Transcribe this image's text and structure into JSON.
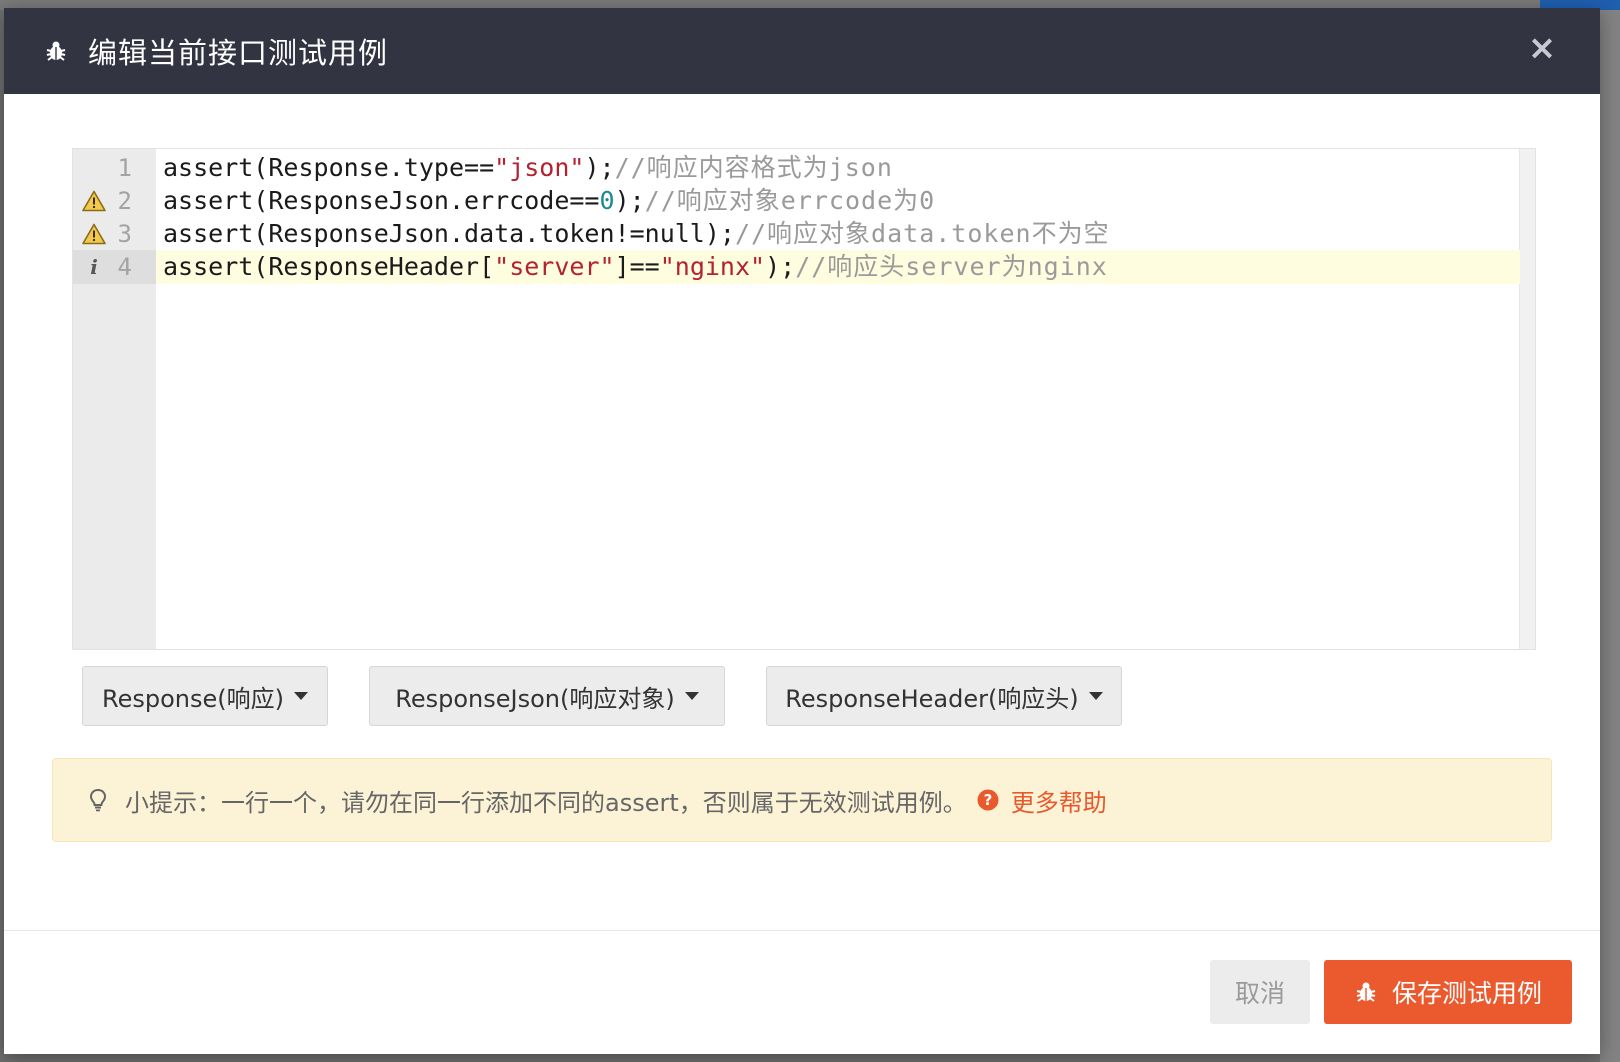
{
  "modal": {
    "title": "编辑当前接口测试用例",
    "close_label": "×",
    "header_icon": "bug-icon"
  },
  "editor": {
    "lines": [
      {
        "number": "1",
        "marker": "",
        "tokens": [
          {
            "t": "assert(Response.type==",
            "c": "plain"
          },
          {
            "t": "\"json\"",
            "c": "str"
          },
          {
            "t": ");",
            "c": "plain"
          },
          {
            "t": "//响应内容格式为json",
            "c": "com"
          }
        ]
      },
      {
        "number": "2",
        "marker": "warning",
        "tokens": [
          {
            "t": "assert(ResponseJson.errcode==",
            "c": "plain"
          },
          {
            "t": "0",
            "c": "num"
          },
          {
            "t": ");",
            "c": "plain"
          },
          {
            "t": "//响应对象errcode为0",
            "c": "com"
          }
        ]
      },
      {
        "number": "3",
        "marker": "warning",
        "tokens": [
          {
            "t": "assert(ResponseJson.data.token!=null);",
            "c": "plain"
          },
          {
            "t": "//响应对象data.token不为空",
            "c": "com"
          }
        ]
      },
      {
        "number": "4",
        "marker": "info",
        "active": true,
        "tokens": [
          {
            "t": "assert(ResponseHeader[",
            "c": "plain"
          },
          {
            "t": "\"server\"",
            "c": "str"
          },
          {
            "t": "]==",
            "c": "plain"
          },
          {
            "t": "\"nginx\"",
            "c": "str"
          },
          {
            "t": ");",
            "c": "plain"
          },
          {
            "t": "//响应头server为nginx",
            "c": "com"
          }
        ]
      }
    ]
  },
  "snippet_buttons": [
    {
      "label": "Response(响应)"
    },
    {
      "label": "ResponseJson(响应对象)"
    },
    {
      "label": "ResponseHeader(响应头)"
    }
  ],
  "tip": {
    "text": "小提示：一行一个，请勿在同一行添加不同的assert，否则属于无效测试用例。",
    "help_label": "更多帮助",
    "icon": "lightbulb-icon",
    "help_icon": "question-circle-icon"
  },
  "footer": {
    "cancel_label": "取消",
    "save_label": "保存测试用例",
    "save_icon": "bug-icon"
  },
  "colors": {
    "header_bg": "#323441",
    "accent": "#ea5a2e",
    "tip_bg": "#fcf3d7",
    "string": "#b4212f",
    "number": "#1c8a96",
    "comment": "#9a9a9a",
    "active_line": "#fefde0"
  }
}
